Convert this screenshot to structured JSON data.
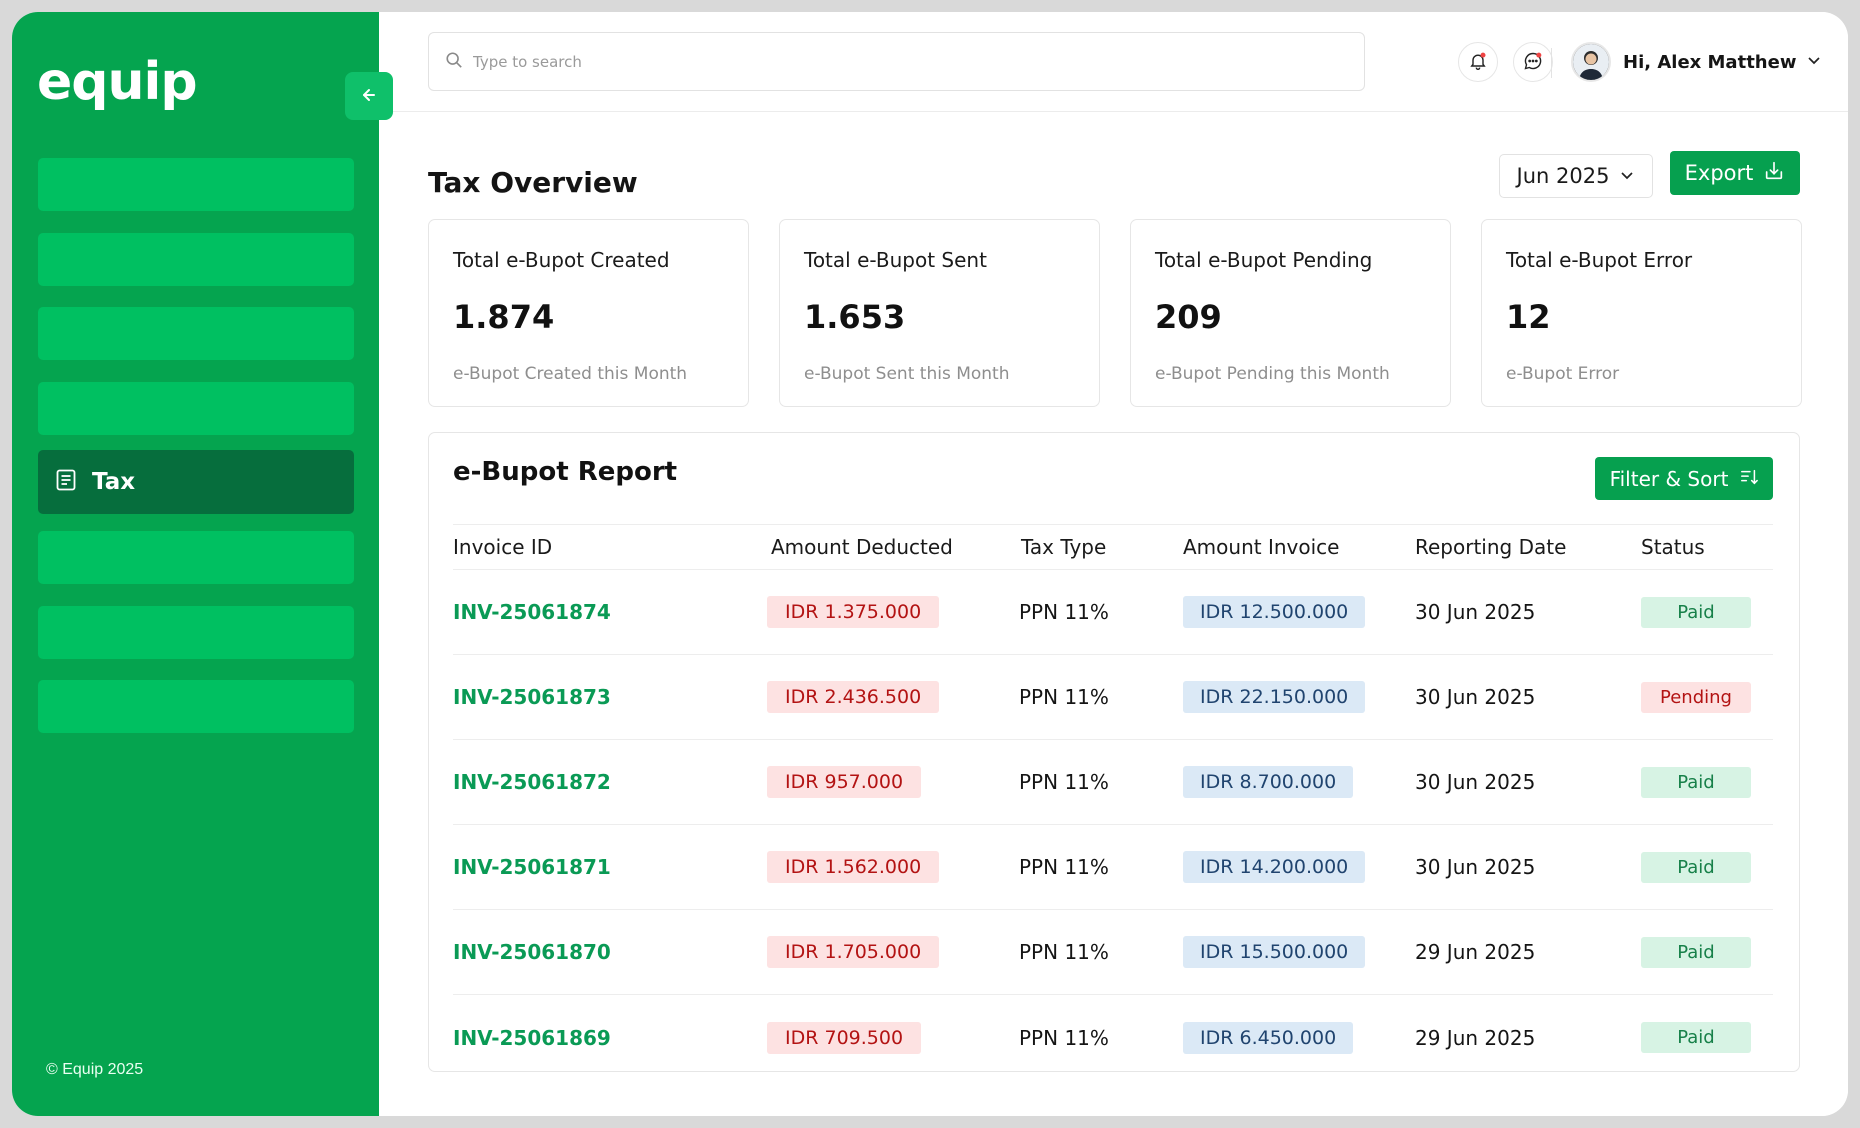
{
  "sidebar": {
    "logo": "equip",
    "active_item": "Tax",
    "copyright": "© Equip 2025"
  },
  "topbar": {
    "search_placeholder": "Type to search",
    "user_greeting": "Hi, Alex Matthew"
  },
  "header": {
    "title": "Tax Overview",
    "period": "Jun 2025",
    "export_label": "Export"
  },
  "cards": [
    {
      "title": "Total e-Bupot Created",
      "value": "1.874",
      "sub": "e-Bupot Created this Month"
    },
    {
      "title": "Total e-Bupot Sent",
      "value": "1.653",
      "sub": "e-Bupot Sent this Month"
    },
    {
      "title": "Total e-Bupot Pending",
      "value": "209",
      "sub": "e-Bupot Pending this Month"
    },
    {
      "title": "Total e-Bupot Error",
      "value": "12",
      "sub": "e-Bupot Error"
    }
  ],
  "report": {
    "title": "e-Bupot Report",
    "filter_label": "Filter & Sort",
    "columns": [
      "Invoice ID",
      "Amount Deducted",
      "Tax Type",
      "Amount Invoice",
      "Reporting Date",
      "Status"
    ],
    "rows": [
      {
        "invoice": "INV-25061874",
        "deducted": "IDR 1.375.000",
        "tax": "PPN 11%",
        "amount": "IDR 12.500.000",
        "date": "30 Jun 2025",
        "status": "Paid"
      },
      {
        "invoice": "INV-25061873",
        "deducted": "IDR 2.436.500",
        "tax": "PPN 11%",
        "amount": "IDR 22.150.000",
        "date": "30 Jun 2025",
        "status": "Pending"
      },
      {
        "invoice": "INV-25061872",
        "deducted": "IDR 957.000",
        "tax": "PPN 11%",
        "amount": "IDR 8.700.000",
        "date": "30 Jun 2025",
        "status": "Paid"
      },
      {
        "invoice": "INV-25061871",
        "deducted": "IDR 1.562.000",
        "tax": "PPN 11%",
        "amount": "IDR 14.200.000",
        "date": "30 Jun 2025",
        "status": "Paid"
      },
      {
        "invoice": "INV-25061870",
        "deducted": "IDR 1.705.000",
        "tax": "PPN 11%",
        "amount": "IDR 15.500.000",
        "date": "29 Jun 2025",
        "status": "Paid"
      },
      {
        "invoice": "INV-25061869",
        "deducted": "IDR 709.500",
        "tax": "PPN 11%",
        "amount": "IDR 6.450.000",
        "date": "29 Jun 2025",
        "status": "Paid"
      }
    ]
  },
  "colors": {
    "sidebar_bg": "#05a44f",
    "nav_item": "#00c061",
    "nav_active": "#066e3d",
    "accent": "#06a04f"
  },
  "icons": {
    "collapse": "arrow-left-icon",
    "search": "search-icon",
    "notification": "bell-icon",
    "messages": "chat-icon",
    "dropdown": "chevron-down-icon",
    "export": "download-icon",
    "filter": "sort-icon",
    "tax": "document-icon"
  }
}
